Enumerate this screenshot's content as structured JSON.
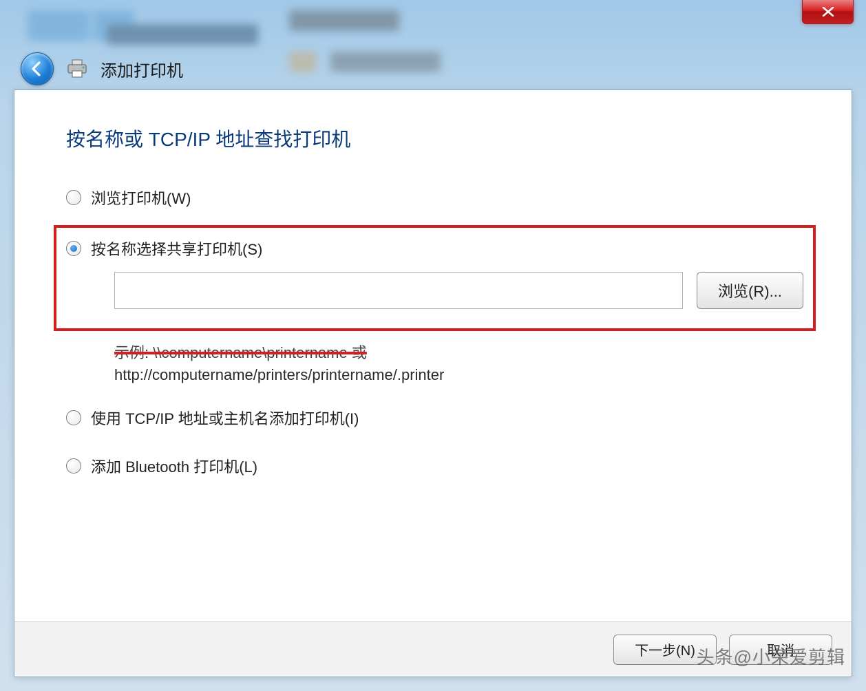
{
  "window": {
    "close_icon": "close",
    "back_icon": "arrow-left",
    "printer_icon": "printer",
    "title": "添加打印机"
  },
  "page": {
    "heading": "按名称或 TCP/IP 地址查找打印机",
    "options": {
      "browse": {
        "label": "浏览打印机(W)",
        "selected": false
      },
      "by_name": {
        "label": "按名称选择共享打印机(S)",
        "selected": true,
        "input_value": "",
        "browse_button": "浏览(R)...",
        "example_line1": "示例: \\\\computername\\printername 或",
        "example_line2": "http://computername/printers/printername/.printer"
      },
      "tcpip": {
        "label": "使用 TCP/IP 地址或主机名添加打印机(I)",
        "selected": false
      },
      "bluetooth": {
        "label": "添加 Bluetooth 打印机(L)",
        "selected": false
      }
    }
  },
  "footer": {
    "next": "下一步(N)",
    "cancel": "取消"
  },
  "watermark": "头条@小荣爱剪辑"
}
